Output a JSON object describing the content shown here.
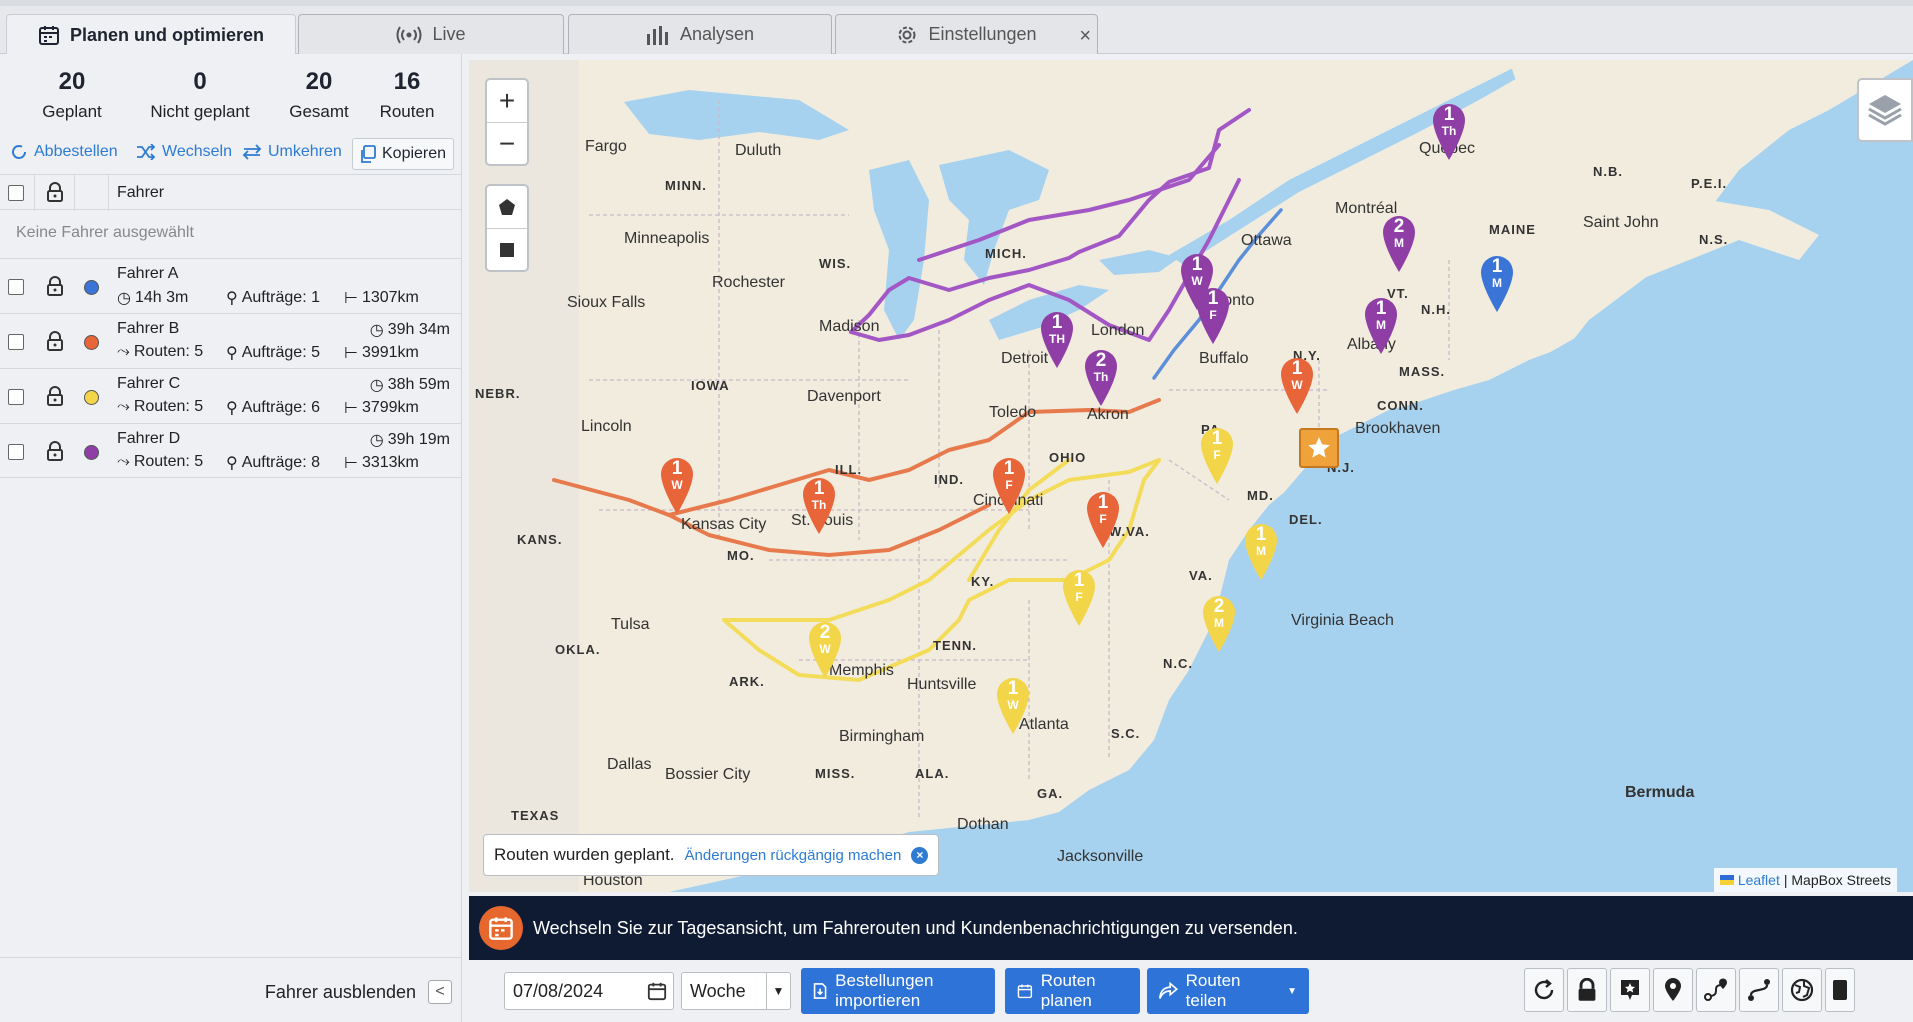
{
  "tabs": [
    {
      "label": "Planen und optimieren",
      "icon": "calendar-icon",
      "active": true
    },
    {
      "label": "Live",
      "icon": "broadcast-icon"
    },
    {
      "label": "Analysen",
      "icon": "bar-chart-icon"
    },
    {
      "label": "Einstellungen",
      "icon": "gear-icon",
      "close": "×"
    }
  ],
  "stats": [
    {
      "value": "20",
      "label": "Geplant"
    },
    {
      "value": "0",
      "label": "Nicht geplant"
    },
    {
      "value": "20",
      "label": "Gesamt"
    },
    {
      "value": "16",
      "label": "Routen"
    }
  ],
  "actions": {
    "cancel": "Abbestellen",
    "swap": "Wechseln",
    "reverse": "Umkehren",
    "copy": "Kopieren"
  },
  "table": {
    "column_driver": "Fahrer",
    "empty_note": "Keine Fahrer ausgewählt"
  },
  "drivers": [
    {
      "name": "Fahrer A",
      "color": "#3a74d6",
      "time": "14h 3m",
      "routes": "",
      "orders": "Aufträge: 1",
      "distance": "1307km"
    },
    {
      "name": "Fahrer B",
      "color": "#e8653a",
      "time": "39h 34m",
      "routes": "Routen: 5",
      "orders": "Aufträge: 5",
      "distance": "3991km"
    },
    {
      "name": "Fahrer C",
      "color": "#f3d54a",
      "time": "38h 59m",
      "routes": "Routen: 5",
      "orders": "Aufträge: 6",
      "distance": "3799km"
    },
    {
      "name": "Fahrer D",
      "color": "#8e3ea5",
      "time": "39h 19m",
      "routes": "Routen: 5",
      "orders": "Aufträge: 8",
      "distance": "3313km"
    }
  ],
  "sidebar_footer": {
    "hide_label": "Fahrer ausblenden",
    "collapse": "<"
  },
  "map": {
    "zoom_in": "+",
    "zoom_out": "−",
    "cities": [
      "Fargo",
      "Duluth",
      "Minneapolis",
      "Rochester",
      "Sioux Falls",
      "Madison",
      "Detroit",
      "London",
      "Toronto",
      "Ottawa",
      "Montréal",
      "Québec",
      "Saint John",
      "Buffalo",
      "Albany",
      "Toledo",
      "Akron",
      "Davenport",
      "Lincoln",
      "Kansas City",
      "St. Louis",
      "Cincinnati",
      "Brookhaven",
      "Tulsa",
      "Memphis",
      "Huntsville",
      "Birmingham",
      "Atlanta",
      "Dallas",
      "Bossier City",
      "Houston",
      "Dothan",
      "Jacksonville",
      "Virginia Beach",
      "Bermuda"
    ],
    "states": [
      "MINN.",
      "WIS.",
      "MICH.",
      "IOWA",
      "NEBR.",
      "ILL.",
      "IND.",
      "OHIO",
      "PA.",
      "N.Y.",
      "VT.",
      "N.H.",
      "MAINE",
      "MASS.",
      "CONN.",
      "N.J.",
      "MD.",
      "DEL.",
      "W.VA.",
      "VA.",
      "KY.",
      "TENN.",
      "N.C.",
      "S.C.",
      "GA.",
      "ALA.",
      "MISS.",
      "ARK.",
      "OKLA.",
      "TEXAS",
      "KANS.",
      "MO.",
      "N.B.",
      "P.E.I.",
      "N.S."
    ],
    "pins": [
      {
        "num": "1",
        "day": "Th",
        "color": "#8e3ea5"
      },
      {
        "num": "2",
        "day": "M",
        "color": "#8e3ea5"
      },
      {
        "num": "1",
        "day": "W",
        "color": "#8e3ea5"
      },
      {
        "num": "1",
        "day": "F",
        "color": "#8e3ea5"
      },
      {
        "num": "1",
        "day": "M",
        "color": "#8e3ea5"
      },
      {
        "num": "1",
        "day": "TH",
        "color": "#8e3ea5"
      },
      {
        "num": "2",
        "day": "Th",
        "color": "#8e3ea5"
      },
      {
        "num": "1",
        "day": "M",
        "color": "#3a74d6"
      },
      {
        "num": "1",
        "day": "W",
        "color": "#e8653a"
      },
      {
        "num": "1",
        "day": "W",
        "color": "#e8653a"
      },
      {
        "num": "1",
        "day": "Th",
        "color": "#e8653a"
      },
      {
        "num": "1",
        "day": "F",
        "color": "#e8653a"
      },
      {
        "num": "1",
        "day": "F",
        "color": "#e8653a"
      },
      {
        "num": "1",
        "day": "F",
        "color": "#f3d54a"
      },
      {
        "num": "1",
        "day": "M",
        "color": "#f3d54a"
      },
      {
        "num": "1",
        "day": "F",
        "color": "#f3d54a"
      },
      {
        "num": "2",
        "day": "M",
        "color": "#f3d54a"
      },
      {
        "num": "2",
        "day": "W",
        "color": "#f3d54a"
      },
      {
        "num": "1",
        "day": "W",
        "color": "#f3d54a"
      }
    ],
    "toast_text": "Routen wurden geplant.",
    "toast_undo": "Änderungen rückgängig machen",
    "toast_close": "×",
    "attribution_leaflet": "Leaflet",
    "attribution_rest": "| MapBox Streets"
  },
  "banner": {
    "text": "Wechseln Sie zur Tagesansicht, um Fahrerouten und Kundenbenachrichtigungen zu versenden."
  },
  "toolbar": {
    "date": "07/08/2024",
    "period": "Woche",
    "import_label": "Bestellungen importieren",
    "plan_label": "Routen planen",
    "share_label": "Routen teilen"
  }
}
